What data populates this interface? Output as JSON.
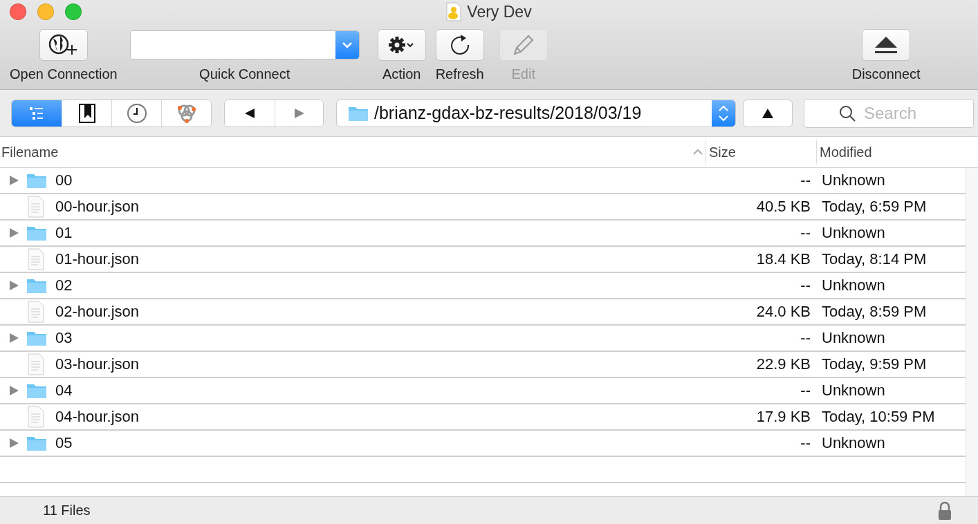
{
  "window": {
    "title": "Very Dev"
  },
  "toolbar": [
    {
      "kind": "globe",
      "label": "Open Connection",
      "disabled": false
    },
    {
      "kind": "combo",
      "label": "Quick Connect"
    },
    {
      "kind": "gear",
      "label": "Action",
      "disabled": false
    },
    {
      "kind": "refresh",
      "label": "Refresh",
      "disabled": false
    },
    {
      "kind": "pencil",
      "label": "Edit",
      "disabled": true
    },
    {
      "kind": "eject",
      "label": "Disconnect",
      "disabled": false
    }
  ],
  "view_tabs": [
    {
      "kind": "outline",
      "selected": true
    },
    {
      "kind": "bookmark",
      "selected": false
    },
    {
      "kind": "clock",
      "selected": false
    },
    {
      "kind": "bonjour",
      "selected": false
    }
  ],
  "path": "/brianz-gdax-bz-results/2018/03/19",
  "search": {
    "placeholder": "Search"
  },
  "table": {
    "columns": [
      "Filename",
      "Size",
      "Modified"
    ],
    "rows": [
      {
        "kind": "folder",
        "expanded": false,
        "name": "00",
        "size": "--",
        "modified": "Unknown"
      },
      {
        "kind": "file",
        "name": "00-hour.json",
        "size": "40.5 KB",
        "modified": "Today, 6:59 PM"
      },
      {
        "kind": "folder",
        "expanded": false,
        "name": "01",
        "size": "--",
        "modified": "Unknown"
      },
      {
        "kind": "file",
        "name": "01-hour.json",
        "size": "18.4 KB",
        "modified": "Today, 8:14 PM"
      },
      {
        "kind": "folder",
        "expanded": false,
        "name": "02",
        "size": "--",
        "modified": "Unknown"
      },
      {
        "kind": "file",
        "name": "02-hour.json",
        "size": "24.0 KB",
        "modified": "Today, 8:59 PM"
      },
      {
        "kind": "folder",
        "expanded": false,
        "name": "03",
        "size": "--",
        "modified": "Unknown"
      },
      {
        "kind": "file",
        "name": "03-hour.json",
        "size": "22.9 KB",
        "modified": "Today, 9:59 PM"
      },
      {
        "kind": "folder",
        "expanded": false,
        "name": "04",
        "size": "--",
        "modified": "Unknown"
      },
      {
        "kind": "file",
        "name": "04-hour.json",
        "size": "17.9 KB",
        "modified": "Today, 10:59 PM"
      },
      {
        "kind": "folder",
        "expanded": false,
        "name": "05",
        "size": "--",
        "modified": "Unknown"
      }
    ]
  },
  "status_bar": {
    "text": "11 Files"
  }
}
